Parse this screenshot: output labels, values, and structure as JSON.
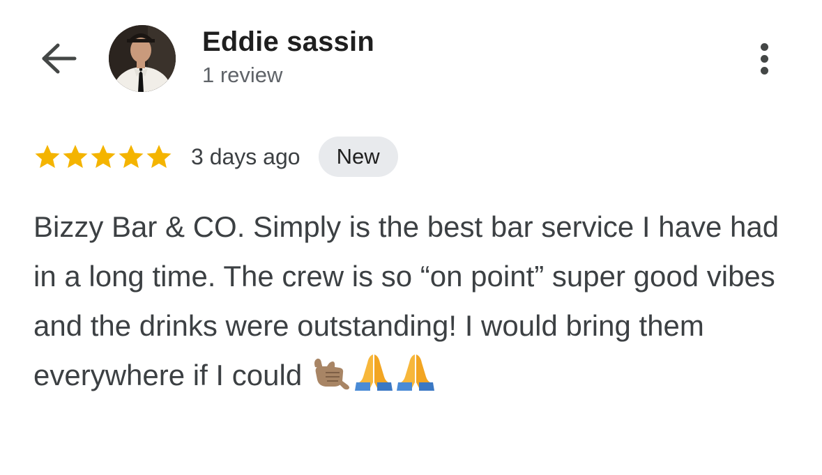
{
  "header": {
    "back_icon": "arrow-back-icon",
    "user_name": "Eddie sassin",
    "review_count": "1 review",
    "more_icon": "more-vert-icon"
  },
  "review": {
    "rating": 5,
    "rating_max": 5,
    "star_color": "#F4B400",
    "time_ago": "3 days ago",
    "badge": "New",
    "text": "Bizzy Bar & CO. Simply is the best bar service I have had in a long time. The crew is so “on point” super good vibes and the drinks were outstanding! I would bring them everywhere if I could",
    "emojis": [
      "call-me-hand-icon",
      "folded-hands-icon",
      "folded-hands-icon"
    ]
  }
}
